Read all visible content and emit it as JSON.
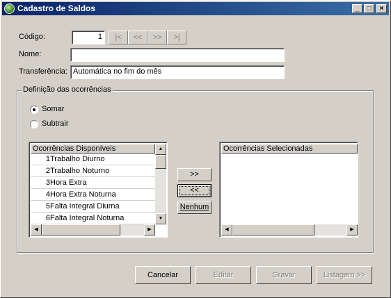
{
  "window": {
    "title": "Cadastro de Saldos",
    "controls": {
      "minimize": "_",
      "maximize": "□",
      "close": "×"
    }
  },
  "form": {
    "codigo_label": "Código:",
    "codigo_value": "1",
    "nav": {
      "first": "|<",
      "prev": "<<",
      "next": ">>",
      "last": ">|"
    },
    "nome_label": "Nome:",
    "nome_value": "",
    "transferencia_label": "Transferência:",
    "transferencia_value": "Automática no fim do mês"
  },
  "group": {
    "title": "Definição das ocorrências",
    "radio_somar": "Somar",
    "radio_subtrair": "Subtrair",
    "selected": "Somar"
  },
  "available": {
    "header": "Ocorrências Disponíveis",
    "items": [
      {
        "num": "1",
        "name": "Trabalho Diurno"
      },
      {
        "num": "2",
        "name": "Trabalho Noturno"
      },
      {
        "num": "3",
        "name": "Hora Extra"
      },
      {
        "num": "4",
        "name": "Hora Extra Noturna"
      },
      {
        "num": "5",
        "name": "Falta Integral Diurna"
      },
      {
        "num": "6",
        "name": "Falta Integral Noturna"
      }
    ]
  },
  "selected_list": {
    "header": "Ocorrências Selecionadas",
    "items": []
  },
  "transfer_buttons": {
    "add": ">>",
    "remove": "<<",
    "none": "Nenhum"
  },
  "footer": {
    "cancel": "Cancelar",
    "edit": "Editar",
    "save": "Gravar",
    "listing": "Listagem >>"
  },
  "icons": {
    "app": "green-globe-icon",
    "scroll_up": "arrow-up-icon",
    "scroll_down": "arrow-down-icon",
    "scroll_left": "arrow-left-icon",
    "scroll_right": "arrow-right-icon"
  }
}
